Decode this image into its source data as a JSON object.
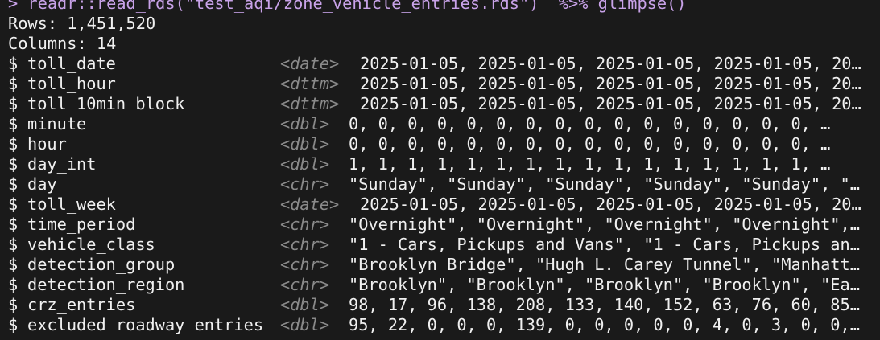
{
  "command": "> readr::read_rds(\"test_aqi/zone_vehicle_entries.rds\")  %>% glimpse()",
  "rows_label": "Rows: 1,451,520",
  "cols_label": "Columns: 14",
  "dollar": "$",
  "columns": [
    {
      "name": "toll_date",
      "type": "<date>",
      "values": "2025-01-05, 2025-01-05, 2025-01-05, 2025-01-05, 20…"
    },
    {
      "name": "toll_hour",
      "type": "<dttm>",
      "values": "2025-01-05, 2025-01-05, 2025-01-05, 2025-01-05, 20…"
    },
    {
      "name": "toll_10min_block",
      "type": "<dttm>",
      "values": "2025-01-05, 2025-01-05, 2025-01-05, 2025-01-05, 20…"
    },
    {
      "name": "minute",
      "type": "<dbl>",
      "values": "0, 0, 0, 0, 0, 0, 0, 0, 0, 0, 0, 0, 0, 0, 0, 0, …"
    },
    {
      "name": "hour",
      "type": "<dbl>",
      "values": "0, 0, 0, 0, 0, 0, 0, 0, 0, 0, 0, 0, 0, 0, 0, 0, …"
    },
    {
      "name": "day_int",
      "type": "<dbl>",
      "values": "1, 1, 1, 1, 1, 1, 1, 1, 1, 1, 1, 1, 1, 1, 1, 1, …"
    },
    {
      "name": "day",
      "type": "<chr>",
      "values": "\"Sunday\", \"Sunday\", \"Sunday\", \"Sunday\", \"Sunday\", \"…"
    },
    {
      "name": "toll_week",
      "type": "<date>",
      "values": "2025-01-05, 2025-01-05, 2025-01-05, 2025-01-05, 20…"
    },
    {
      "name": "time_period",
      "type": "<chr>",
      "values": "\"Overnight\", \"Overnight\", \"Overnight\", \"Overnight\",…"
    },
    {
      "name": "vehicle_class",
      "type": "<chr>",
      "values": "\"1 - Cars, Pickups and Vans\", \"1 - Cars, Pickups an…"
    },
    {
      "name": "detection_group",
      "type": "<chr>",
      "values": "\"Brooklyn Bridge\", \"Hugh L. Carey Tunnel\", \"Manhatt…"
    },
    {
      "name": "detection_region",
      "type": "<chr>",
      "values": "\"Brooklyn\", \"Brooklyn\", \"Brooklyn\", \"Brooklyn\", \"Ea…"
    },
    {
      "name": "crz_entries",
      "type": "<dbl>",
      "values": "98, 17, 96, 138, 208, 133, 140, 152, 63, 76, 60, 85…"
    },
    {
      "name": "excluded_roadway_entries",
      "type": "<dbl>",
      "values": "95, 22, 0, 0, 0, 139, 0, 0, 0, 0, 0, 4, 0, 3, 0, 0,…"
    }
  ],
  "colors": {
    "background": "#1a1a1a",
    "text": "#f0f0f0",
    "prompt": "#c8a2e8",
    "type_hint": "#8a8a8a"
  }
}
